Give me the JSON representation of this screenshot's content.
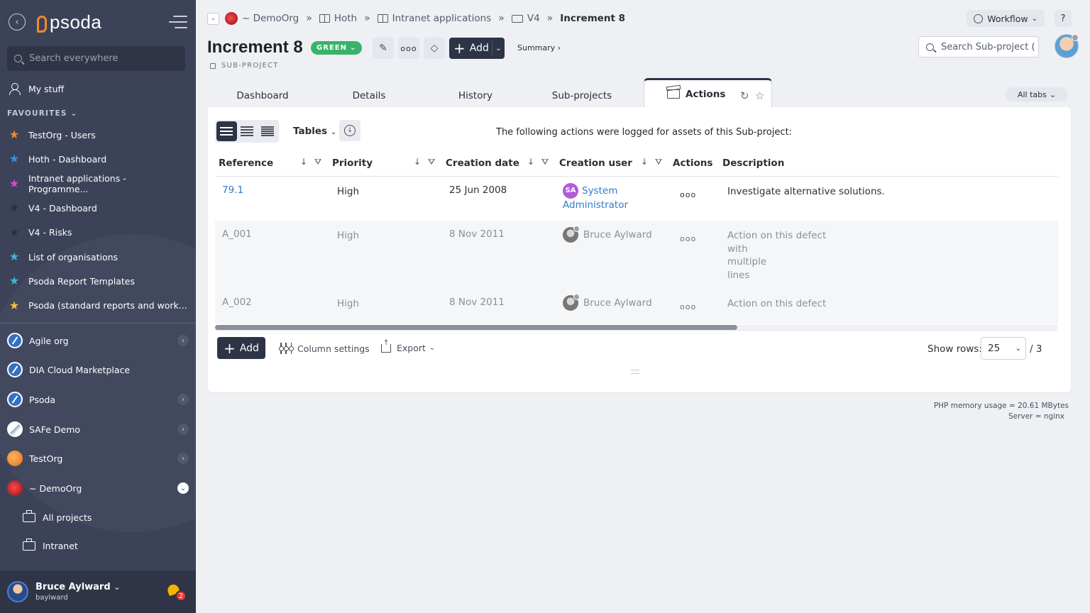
{
  "sidebar": {
    "search_placeholder": "Search everywhere",
    "my_stuff": "My stuff",
    "favourites_heading": "FAVOURITES",
    "favourites": [
      {
        "label": "TestOrg - Users",
        "color": "#f08a2b"
      },
      {
        "label": "Hoth - Dashboard",
        "color": "#3d8fe0"
      },
      {
        "label": "Intranet applications - Programme...",
        "color": "#d64ad0"
      },
      {
        "label": "V4 - Dashboard",
        "color": "#2b2f36"
      },
      {
        "label": "V4 - Risks",
        "color": "#2b2f36"
      },
      {
        "label": "List of organisations",
        "color": "#3fb8d6"
      },
      {
        "label": "Psoda Report Templates",
        "color": "#3fb8d6"
      },
      {
        "label": "Psoda (standard reports and work...",
        "color": "#f2c230"
      }
    ],
    "orgs": [
      {
        "label": "Agile org",
        "style": "blue",
        "expanded": false
      },
      {
        "label": "DIA Cloud Marketplace",
        "style": "blue",
        "expanded": null
      },
      {
        "label": "Psoda",
        "style": "blue",
        "expanded": false
      },
      {
        "label": "SAFe Demo",
        "style": "safe",
        "expanded": false
      },
      {
        "label": "TestOrg",
        "style": "test",
        "expanded": false
      },
      {
        "label": "~ DemoOrg",
        "style": "demo",
        "expanded": true
      }
    ],
    "sub_items": [
      "All projects",
      "Intranet"
    ],
    "user": {
      "name": "Bruce Aylward",
      "login": "baylward",
      "notifications": "2"
    }
  },
  "logo": {
    "text": "psoda"
  },
  "breadcrumb": [
    "~ DemoOrg",
    "Hoth",
    "Intranet applications",
    "V4",
    "Increment 8"
  ],
  "header": {
    "workflow_label": "Workflow",
    "help_label": "?",
    "title": "Increment 8",
    "status": "GREEN",
    "status_color": "#38b368",
    "subtype": "SUB-PROJECT",
    "add_label": "Add",
    "summary_label": "Summary ›",
    "search_placeholder": "Search Sub-project ("
  },
  "tabs": [
    "Dashboard",
    "Details",
    "History",
    "Sub-projects",
    "Actions"
  ],
  "active_tab": "Actions",
  "all_tabs_label": "All tabs",
  "panel": {
    "tables_label": "Tables",
    "intro": "The following actions were logged for assets of this Sub-project:",
    "columns": [
      "Reference",
      "Priority",
      "Creation date",
      "Creation user",
      "Actions",
      "Description"
    ],
    "rows": [
      {
        "reference": "79.1",
        "priority": "High",
        "date": "25 Jun 2008",
        "user_line1": "System",
        "user_line2": "Administrator",
        "user_initials": "SA",
        "description": [
          "Investigate alternative solutions."
        ]
      },
      {
        "reference": "A_001",
        "priority": "High",
        "date": "8 Nov 2011",
        "user_line1": "Bruce Aylward",
        "user_line2": "",
        "description": [
          "Action on this defect",
          "with",
          "multiple",
          "lines"
        ]
      },
      {
        "reference": "A_002",
        "priority": "High",
        "date": "8 Nov 2011",
        "user_line1": "Bruce Aylward",
        "user_line2": "",
        "description": [
          "Action on this defect"
        ]
      }
    ],
    "actions_glyph": "ooo",
    "add_label": "Add",
    "column_settings_label": "Column settings",
    "export_label": "Export",
    "show_rows_label": "Show rows:",
    "rows_per_page": "25",
    "total": "/ 3"
  },
  "server": {
    "memory": "PHP memory usage = 20.61 MBytes",
    "server": "Server = nginx"
  }
}
